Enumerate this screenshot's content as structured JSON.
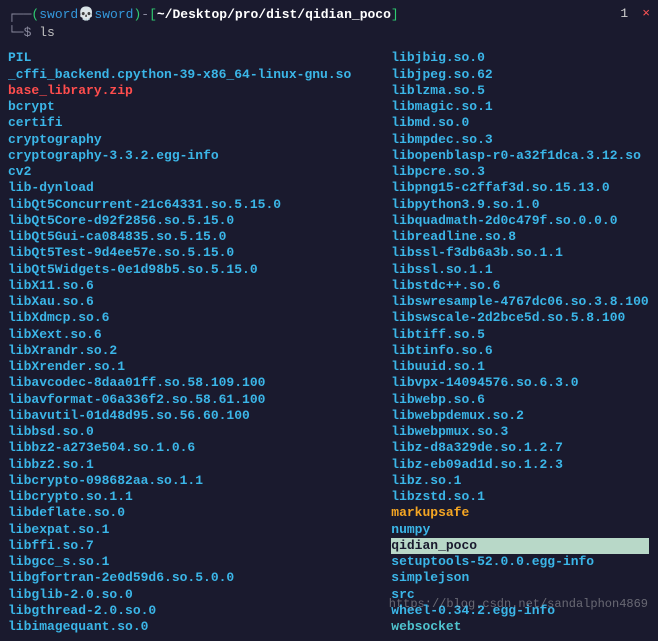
{
  "prompt": {
    "user": "sword",
    "host": "sword",
    "skull": "💀",
    "path": "~/Desktop/pro/dist/qidian_poco",
    "command": "ls"
  },
  "topright": {
    "num": "1",
    "close": "×"
  },
  "watermark": "https://blog.csdn.net/sandalphon4869",
  "listing_left": [
    {
      "t": "PIL",
      "c": "c-dir"
    },
    {
      "t": "_cffi_backend.cpython-39-x86_64-linux-gnu.so",
      "c": "c-file"
    },
    {
      "t": "base_library.zip",
      "c": "c-red"
    },
    {
      "t": "bcrypt",
      "c": "c-dir"
    },
    {
      "t": "certifi",
      "c": "c-dir"
    },
    {
      "t": "cryptography",
      "c": "c-dir"
    },
    {
      "t": "cryptography-3.3.2.egg-info",
      "c": "c-dir"
    },
    {
      "t": "cv2",
      "c": "c-dir"
    },
    {
      "t": "lib-dynload",
      "c": "c-dir"
    },
    {
      "t": "libQt5Concurrent-21c64331.so.5.15.0",
      "c": "c-file"
    },
    {
      "t": "libQt5Core-d92f2856.so.5.15.0",
      "c": "c-file"
    },
    {
      "t": "libQt5Gui-ca084835.so.5.15.0",
      "c": "c-file"
    },
    {
      "t": "libQt5Test-9d4ee57e.so.5.15.0",
      "c": "c-file"
    },
    {
      "t": "libQt5Widgets-0e1d98b5.so.5.15.0",
      "c": "c-file"
    },
    {
      "t": "libX11.so.6",
      "c": "c-file"
    },
    {
      "t": "libXau.so.6",
      "c": "c-file"
    },
    {
      "t": "libXdmcp.so.6",
      "c": "c-file"
    },
    {
      "t": "libXext.so.6",
      "c": "c-file"
    },
    {
      "t": "libXrandr.so.2",
      "c": "c-file"
    },
    {
      "t": "libXrender.so.1",
      "c": "c-file"
    },
    {
      "t": "libavcodec-8daa01ff.so.58.109.100",
      "c": "c-file"
    },
    {
      "t": "libavformat-06a336f2.so.58.61.100",
      "c": "c-file"
    },
    {
      "t": "libavutil-01d48d95.so.56.60.100",
      "c": "c-file"
    },
    {
      "t": "libbsd.so.0",
      "c": "c-file"
    },
    {
      "t": "libbz2-a273e504.so.1.0.6",
      "c": "c-file"
    },
    {
      "t": "libbz2.so.1",
      "c": "c-file"
    },
    {
      "t": "libcrypto-098682aa.so.1.1",
      "c": "c-file"
    },
    {
      "t": "libcrypto.so.1.1",
      "c": "c-file"
    },
    {
      "t": "libdeflate.so.0",
      "c": "c-file"
    },
    {
      "t": "libexpat.so.1",
      "c": "c-file"
    },
    {
      "t": "libffi.so.7",
      "c": "c-file"
    },
    {
      "t": "libgcc_s.so.1",
      "c": "c-file"
    },
    {
      "t": "libgfortran-2e0d59d6.so.5.0.0",
      "c": "c-file"
    },
    {
      "t": "libglib-2.0.so.0",
      "c": "c-file"
    },
    {
      "t": "libgthread-2.0.so.0",
      "c": "c-file"
    },
    {
      "t": "libimagequant.so.0",
      "c": "c-file"
    }
  ],
  "listing_right": [
    {
      "t": "libjbig.so.0",
      "c": "c-file"
    },
    {
      "t": "libjpeg.so.62",
      "c": "c-file"
    },
    {
      "t": "liblzma.so.5",
      "c": "c-file"
    },
    {
      "t": "libmagic.so.1",
      "c": "c-file"
    },
    {
      "t": "libmd.so.0",
      "c": "c-file"
    },
    {
      "t": "libmpdec.so.3",
      "c": "c-file"
    },
    {
      "t": "libopenblasp-r0-a32f1dca.3.12.so",
      "c": "c-file"
    },
    {
      "t": "libpcre.so.3",
      "c": "c-file"
    },
    {
      "t": "libpng15-c2ffaf3d.so.15.13.0",
      "c": "c-file"
    },
    {
      "t": "libpython3.9.so.1.0",
      "c": "c-file"
    },
    {
      "t": "libquadmath-2d0c479f.so.0.0.0",
      "c": "c-file"
    },
    {
      "t": "libreadline.so.8",
      "c": "c-file"
    },
    {
      "t": "libssl-f3db6a3b.so.1.1",
      "c": "c-file"
    },
    {
      "t": "libssl.so.1.1",
      "c": "c-file"
    },
    {
      "t": "libstdc++.so.6",
      "c": "c-file"
    },
    {
      "t": "libswresample-4767dc06.so.3.8.100",
      "c": "c-file"
    },
    {
      "t": "libswscale-2d2bce5d.so.5.8.100",
      "c": "c-file"
    },
    {
      "t": "libtiff.so.5",
      "c": "c-file"
    },
    {
      "t": "libtinfo.so.6",
      "c": "c-file"
    },
    {
      "t": "libuuid.so.1",
      "c": "c-file"
    },
    {
      "t": "libvpx-14094576.so.6.3.0",
      "c": "c-file"
    },
    {
      "t": "libwebp.so.6",
      "c": "c-file"
    },
    {
      "t": "libwebpdemux.so.2",
      "c": "c-file"
    },
    {
      "t": "libwebpmux.so.3",
      "c": "c-file"
    },
    {
      "t": "libz-d8a329de.so.1.2.7",
      "c": "c-file"
    },
    {
      "t": "libz-eb09ad1d.so.1.2.3",
      "c": "c-file"
    },
    {
      "t": "libz.so.1",
      "c": "c-file"
    },
    {
      "t": "libzstd.so.1",
      "c": "c-file"
    },
    {
      "t": "markupsafe",
      "c": "c-orng"
    },
    {
      "t": "numpy",
      "c": "c-dir"
    },
    {
      "t": "qidian_poco",
      "c": "c-hi"
    },
    {
      "t": "setuptools-52.0.0.egg-info",
      "c": "c-dir"
    },
    {
      "t": "simplejson",
      "c": "c-dir"
    },
    {
      "t": "src",
      "c": "c-dir"
    },
    {
      "t": "wheel-0.34.2.egg-info",
      "c": "c-dir"
    },
    {
      "t": "websocket",
      "c": "c-link"
    }
  ]
}
